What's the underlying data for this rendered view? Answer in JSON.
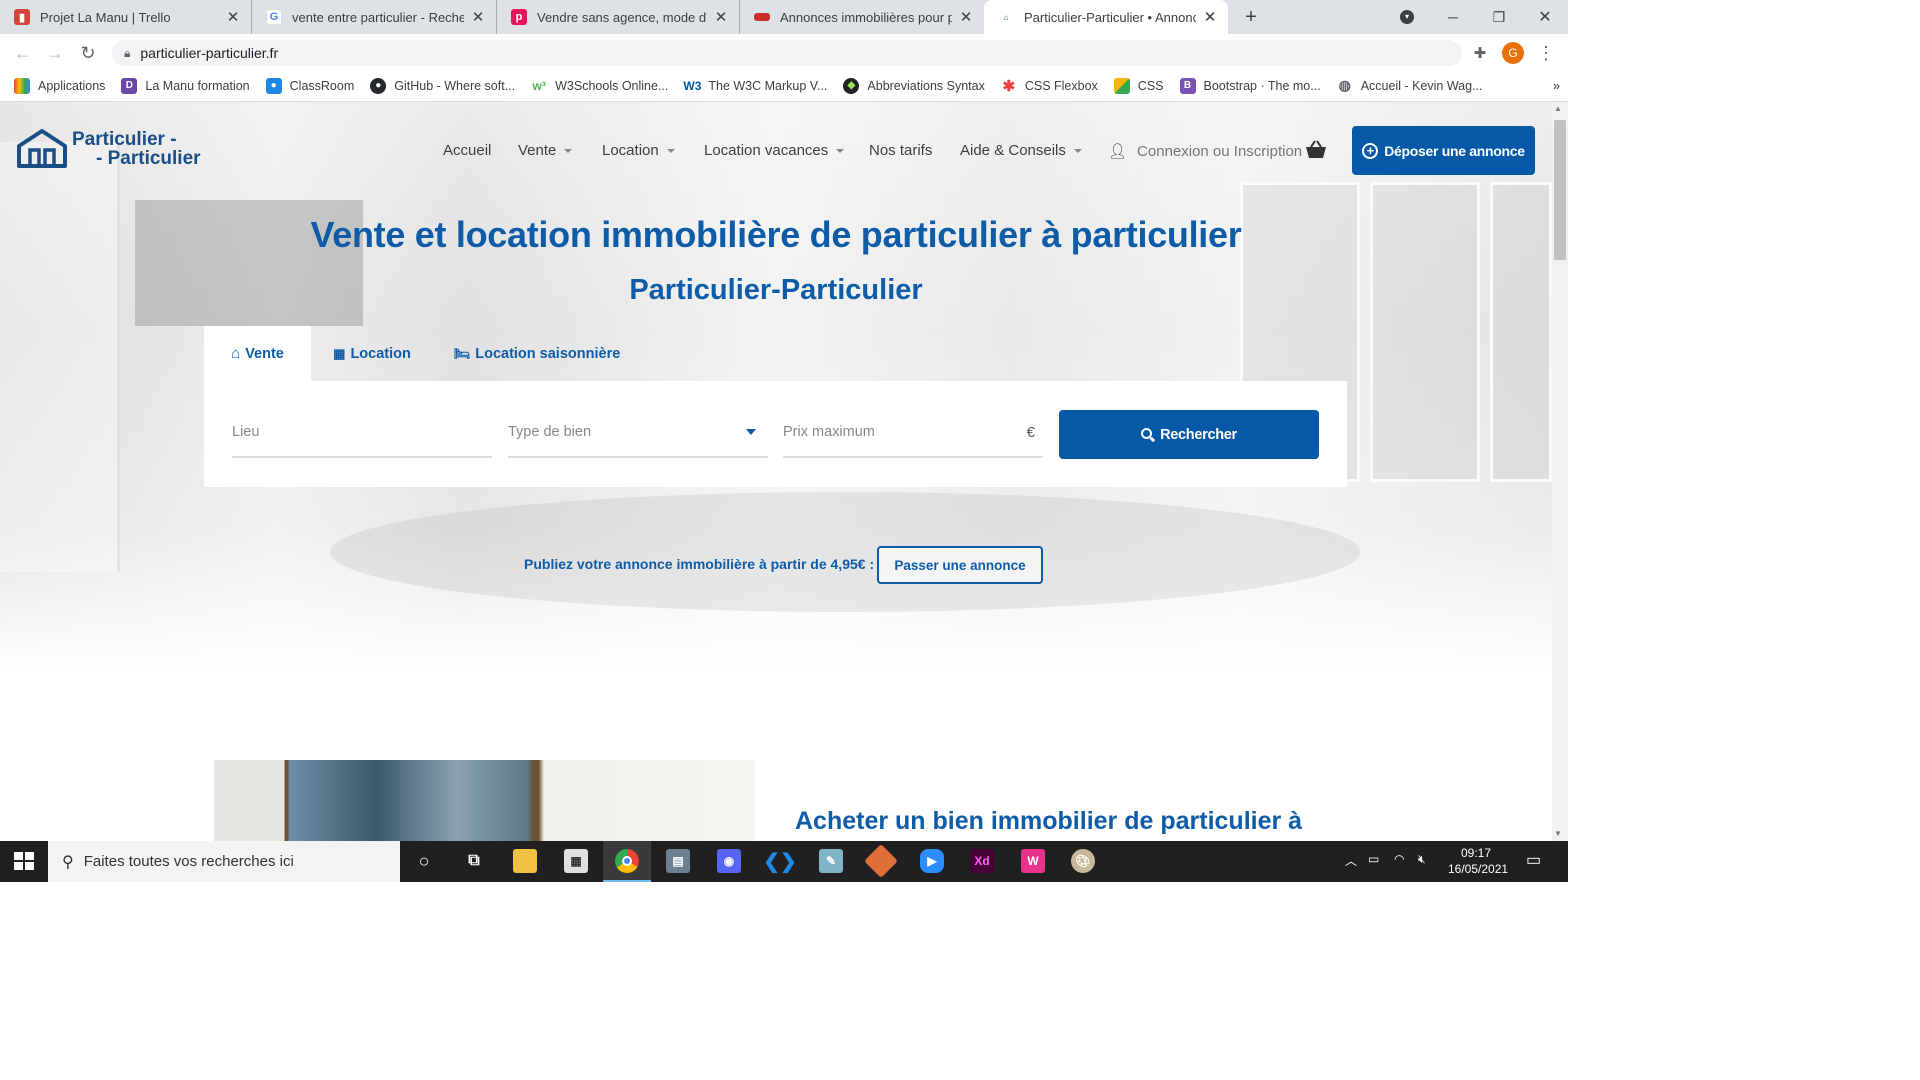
{
  "browser": {
    "tabs": [
      {
        "title": "Projet La Manu | Trello",
        "icon": "trello-icon",
        "color": "#d1453b"
      },
      {
        "title": "vente entre particulier - Recherche",
        "icon": "google-icon",
        "color": "#4285f4"
      },
      {
        "title": "Vendre sans agence, mode d'emploi",
        "icon": "pap-icon",
        "color": "#e5145a"
      },
      {
        "title": "Annonces immobilières pour particuliers",
        "icon": "annonces-icon",
        "color": "#c9302c"
      },
      {
        "title": "Particulier-Particulier • Annonces",
        "icon": "pp-icon",
        "color": "#1b4e86"
      }
    ],
    "new_tab": "+",
    "url": "particulier-particulier.fr",
    "profile_initial": "G",
    "bookmarks": [
      {
        "label": "Applications",
        "icon": "apps-grid-icon",
        "color": "#ea4335"
      },
      {
        "label": "La Manu formation",
        "icon": "lamanu-icon",
        "color": "#6c47a6"
      },
      {
        "label": "ClassRoom",
        "icon": "classroom-icon",
        "color": "#1e88e5"
      },
      {
        "label": "GitHub - Where soft...",
        "icon": "github-icon",
        "color": "#24292e"
      },
      {
        "label": "W3Schools Online...",
        "icon": "w3schools-icon",
        "color": "#4caf50"
      },
      {
        "label": "The W3C Markup V...",
        "icon": "w3c-icon",
        "color": "#005a9c"
      },
      {
        "label": "Abbreviations Syntax",
        "icon": "emmet-icon",
        "color": "#222222"
      },
      {
        "label": "CSS Flexbox",
        "icon": "flexbox-icon",
        "color": "#e8453c"
      },
      {
        "label": "CSS",
        "icon": "css-icon",
        "color": "#f4b400"
      },
      {
        "label": "Bootstrap · The mo...",
        "icon": "bootstrap-icon",
        "color": "#7952b3"
      },
      {
        "label": "Accueil - Kevin Wag...",
        "icon": "globe-icon",
        "color": "#5f6368"
      }
    ],
    "more_bookmarks": "»"
  },
  "site": {
    "logo_line1": "Particulier -",
    "logo_line2": "- Particulier",
    "nav": [
      {
        "label": "Accueil",
        "dropdown": false
      },
      {
        "label": "Vente",
        "dropdown": true
      },
      {
        "label": "Location",
        "dropdown": true
      },
      {
        "label": "Location vacances",
        "dropdown": true
      },
      {
        "label": "Nos tarifs",
        "dropdown": false
      },
      {
        "label": "Aide & Conseils",
        "dropdown": true
      }
    ],
    "login": "Connexion ou Inscription",
    "cta": "Déposer une annonce",
    "colors": {
      "primary": "#0659a6",
      "title": "#0e5ca8",
      "logo": "#1b4e86"
    }
  },
  "hero": {
    "title": "Vente et location immobilière de particulier à particulier",
    "subtitle": "Particulier-Particulier",
    "tabs": [
      {
        "label": "Vente",
        "icon": "home-icon",
        "active": true
      },
      {
        "label": "Location",
        "icon": "building-icon",
        "active": false
      },
      {
        "label": "Location saisonnière",
        "icon": "bed-icon",
        "active": false
      }
    ],
    "search": {
      "lieu_placeholder": "Lieu",
      "type_placeholder": "Type de bien",
      "prix_placeholder": "Prix maximum",
      "currency": "€",
      "button": "Rechercher"
    },
    "publish_text": "Publiez votre annonce immobilière à partir de 4,95€ :",
    "publish_button": "Passer une annonce"
  },
  "section": {
    "title": "Acheter un bien immobilier de particulier à particulier"
  },
  "taskbar": {
    "search_placeholder": "Faites toutes vos recherches ici",
    "time": "09:17",
    "date": "16/05/2021",
    "apps": [
      {
        "icon": "cortana-icon",
        "color": "#202020",
        "glyph": "○"
      },
      {
        "icon": "task-view-icon",
        "color": "#202020",
        "glyph": "⧉"
      },
      {
        "icon": "file-explorer-icon",
        "color": "#f0c040",
        "glyph": ""
      },
      {
        "icon": "store-icon",
        "color": "#e0e0e0",
        "glyph": ""
      },
      {
        "icon": "chrome-icon",
        "color": "#34a853",
        "glyph": ""
      },
      {
        "icon": "calculator-icon",
        "color": "#6d7f91",
        "glyph": ""
      },
      {
        "icon": "discord-icon",
        "color": "#5865f2",
        "glyph": ""
      },
      {
        "icon": "vscode-icon",
        "color": "#1e88e5",
        "glyph": ""
      },
      {
        "icon": "notepad-icon",
        "color": "#7fb3c6",
        "glyph": ""
      },
      {
        "icon": "git-icon",
        "color": "#e06e3a",
        "glyph": ""
      },
      {
        "icon": "zoom-icon",
        "color": "#2d8cff",
        "glyph": ""
      },
      {
        "icon": "adobe-xd-icon",
        "color": "#470137",
        "glyph": "Xd"
      },
      {
        "icon": "wamp-icon",
        "color": "#e6348c",
        "glyph": "W"
      },
      {
        "icon": "paint-icon",
        "color": "#c8b89a",
        "glyph": ""
      }
    ]
  }
}
